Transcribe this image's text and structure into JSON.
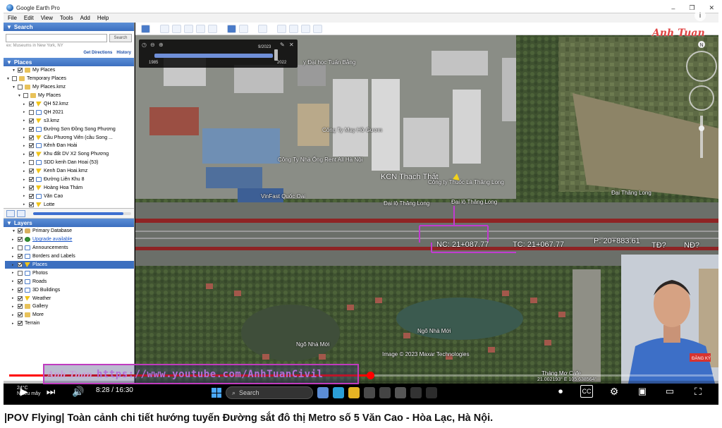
{
  "window": {
    "title": "Google Earth Pro",
    "controls": [
      "–",
      "❐",
      "✕"
    ]
  },
  "menu": [
    "File",
    "Edit",
    "View",
    "Tools",
    "Add",
    "Help"
  ],
  "search": {
    "header": "Search",
    "button": "Search",
    "hint": "ex: Museums in New York, NY",
    "get_directions": "Get Directions",
    "history": "History"
  },
  "places": {
    "header": "Places",
    "items": [
      {
        "label": "My Places",
        "checked": true,
        "depth": 1
      },
      {
        "label": "Temporary Places",
        "checked": false,
        "depth": 0
      },
      {
        "label": "My Places.kmz",
        "checked": false,
        "depth": 1
      },
      {
        "label": "My Places",
        "checked": false,
        "depth": 2
      },
      {
        "label": "QH 52.kmz",
        "checked": true,
        "depth": 3
      },
      {
        "label": "QH 2021",
        "checked": false,
        "depth": 3
      },
      {
        "label": "s3.kmz",
        "checked": true,
        "depth": 3
      },
      {
        "label": "Đường Sơn Đồng Song Phương",
        "checked": true,
        "depth": 3
      },
      {
        "label": "Cầu Phương Viên (cầu Song ...",
        "checked": true,
        "depth": 3
      },
      {
        "label": "Kênh Đan Hoài",
        "checked": true,
        "depth": 3
      },
      {
        "label": "Khu đất DV X2 Song Phương",
        "checked": true,
        "depth": 3
      },
      {
        "label": "SDD kenh Dan Hoai (53)",
        "checked": false,
        "depth": 3
      },
      {
        "label": "Kenh Dan Hoai.kmz",
        "checked": true,
        "depth": 3
      },
      {
        "label": "Đường Liên Khu 8",
        "checked": true,
        "depth": 3
      },
      {
        "label": "Hoàng Hoa Thám",
        "checked": true,
        "depth": 3
      },
      {
        "label": "Văn Cao",
        "checked": true,
        "depth": 3
      },
      {
        "label": "Lotte",
        "checked": true,
        "depth": 3
      }
    ]
  },
  "layers": {
    "header": "Layers",
    "items": [
      {
        "label": "Primary Database",
        "checked": true,
        "icon": "db"
      },
      {
        "label": "Upgrade available",
        "checked": true,
        "icon": "globe",
        "link": true
      },
      {
        "label": "Announcements",
        "checked": false,
        "icon": "poly"
      },
      {
        "label": "Borders and Labels",
        "checked": true,
        "icon": "poly"
      },
      {
        "label": "Places",
        "checked": true,
        "icon": "pin",
        "selected": true
      },
      {
        "label": "Photos",
        "checked": false,
        "icon": "poly"
      },
      {
        "label": "Roads",
        "checked": true,
        "icon": "poly"
      },
      {
        "label": "3D Buildings",
        "checked": true,
        "icon": "poly"
      },
      {
        "label": "Weather",
        "checked": true,
        "icon": "pin"
      },
      {
        "label": "Gallery",
        "checked": true,
        "icon": "folder"
      },
      {
        "label": "More",
        "checked": true,
        "icon": "folder"
      },
      {
        "label": "Terrain",
        "checked": true,
        "icon": "none"
      }
    ]
  },
  "timebox": {
    "start_year": "1985",
    "end_year": "2022",
    "current": "9/2023"
  },
  "map_labels": {
    "kcn": "KCN Thạch Thất",
    "cong_ty_thuoc_la": "Công ty Thuốc Lá Thăng Long",
    "vinfast": "VinFast Quốc Oai",
    "cong_ty_may": "Công Ty May Hồ Gươm",
    "cong_ty_nha": "Công Ty Nhà Ống Rent All Hà Nội",
    "dai_hoc": "y Đại học Tuấn Bằng",
    "dl_thang_long_1": "Đại lộ Thăng Long",
    "dl_thang_long_2": "Đại lộ Thăng Long",
    "dl_thang_long_3": "Đại Thăng Long",
    "nc": "NC: 21+087.77",
    "tc": "TC: 21+067.77",
    "p": "P: 20+883.61",
    "td": "TĐ?",
    "nd": "NĐ?",
    "ngo_1": "Ngõ Nhà Mới",
    "ngo_2": "Ngõ Nhà Mới",
    "copyright": "Image © 2023 Maxar Technologies",
    "cafe": "Tháng Mơ Cafe",
    "coords": "21.002193° E 105.638564°"
  },
  "watermark": "Anh Tuan",
  "url_banner": {
    "signature": "Anh Tuan",
    "url": "https://www.youtube.com/AnhTuanCivil"
  },
  "player": {
    "time": "8:28 / 16:30",
    "progress": 0.513
  },
  "taskbar": {
    "search_placeholder": "Search"
  },
  "weather": {
    "temp": "24°C",
    "desc": "Nhiều mây"
  },
  "webcam": {
    "badge": "ĐĂNG KÝ"
  },
  "video_title": "|POV Flying| Toàn cảnh chi tiết hướng tuyến Đường sắt đô thị Metro số 5 Văn Cao - Hòa Lạc, Hà Nội.",
  "colors": {
    "panel_head": "#3c6fbf",
    "progress": "#ff0000",
    "banner_border": "#c03bbf",
    "measure_line": "#c23bd0"
  }
}
